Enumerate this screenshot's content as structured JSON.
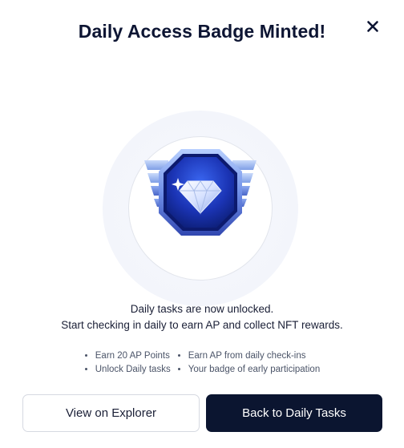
{
  "modal": {
    "title": "Daily Access Badge Minted!",
    "close_icon": "close-icon"
  },
  "badge": {
    "icon": "diamond-badge-icon",
    "colors": {
      "primary": "#1f3fb8",
      "dark": "#0e1f7a",
      "light": "#8fb0ff",
      "wing": "#a9c3f4"
    }
  },
  "description": {
    "line1": "Daily tasks are now unlocked.",
    "line2": "Start checking in daily to earn AP and collect NFT rewards."
  },
  "benefits": {
    "left": [
      "Earn 20 AP Points",
      "Unlock Daily tasks"
    ],
    "right": [
      "Earn AP from daily check-ins",
      "Your badge of early participation"
    ]
  },
  "actions": {
    "secondary_label": "View on Explorer",
    "primary_label": "Back to Daily Tasks",
    "primary_color": "#0b1530"
  }
}
